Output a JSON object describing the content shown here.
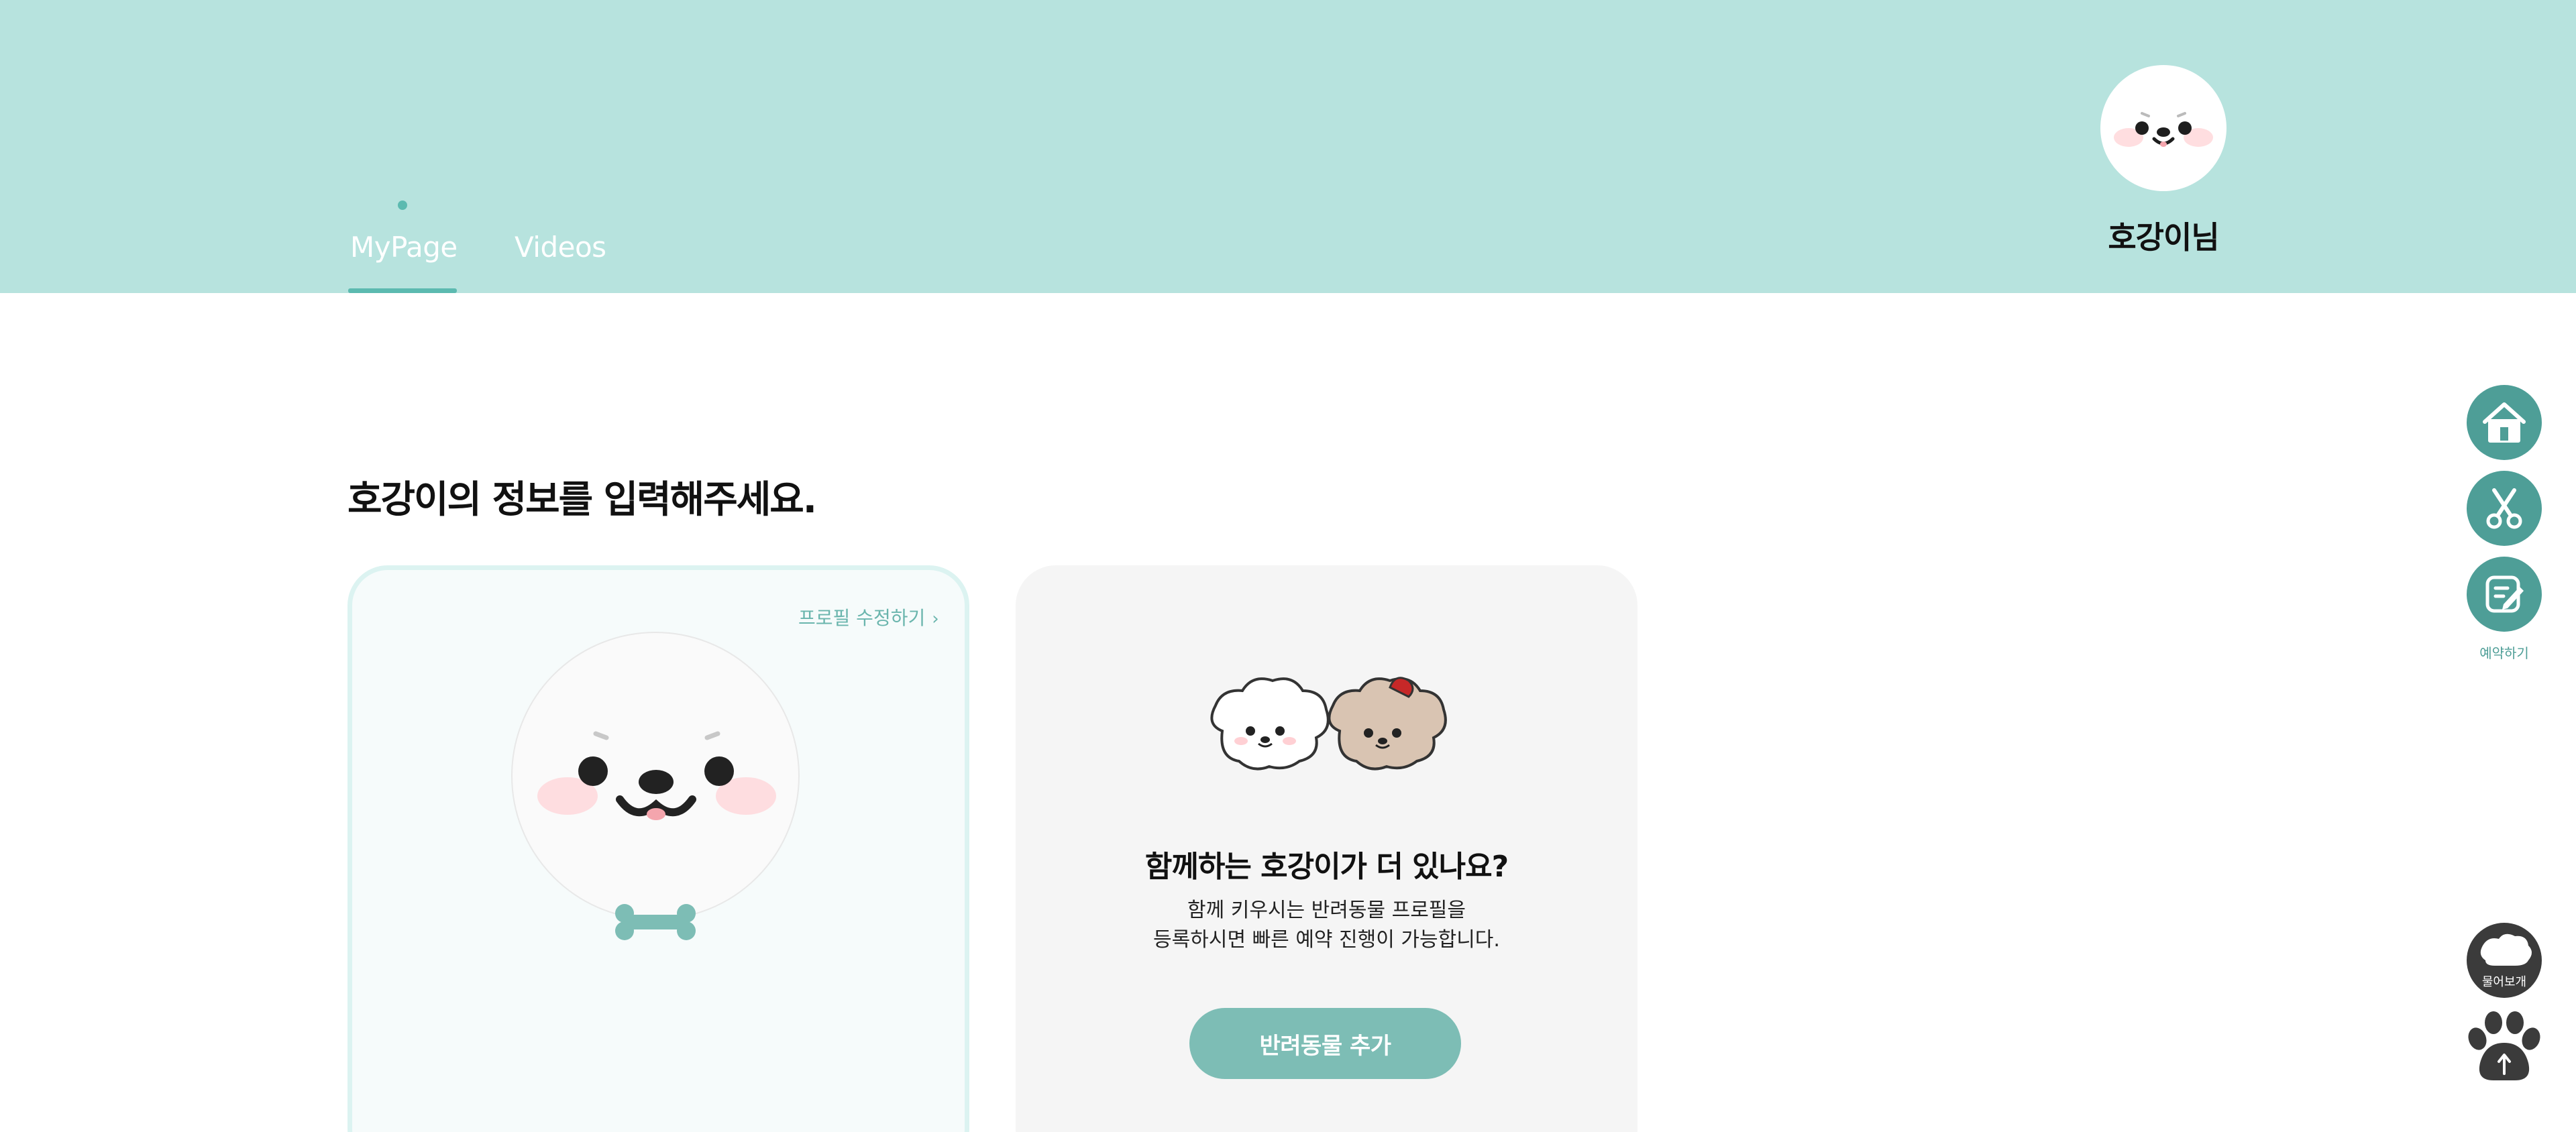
{
  "nav": {
    "tabs": [
      {
        "label": "MyPage"
      },
      {
        "label": "Videos"
      }
    ]
  },
  "user": {
    "name": "호강이님",
    "avatar_icon": "dog-face-avatar"
  },
  "main": {
    "title": "호강이의 정보를 입력해주세요."
  },
  "profile_card": {
    "edit_label": "프로필 수정하기",
    "photo_icon": "dog-face-photo",
    "bone_icon": "bone-icon"
  },
  "add_card": {
    "title": "함께하는 호강이가 더 있나요?",
    "desc_line1": "함께 키우시는 반려동물 프로필을",
    "desc_line2": "등록하시면 빠른 예약 진행이 가능합니다.",
    "button_label": "반려동물 추가"
  },
  "quick_menu": {
    "reserve_label": "예약하기",
    "ask_label": "물어보개"
  },
  "colors": {
    "header_bg": "#b7e3de",
    "accent": "#5cbab0",
    "button": "#7dbdb5",
    "quick_menu": "#4e9e97"
  }
}
